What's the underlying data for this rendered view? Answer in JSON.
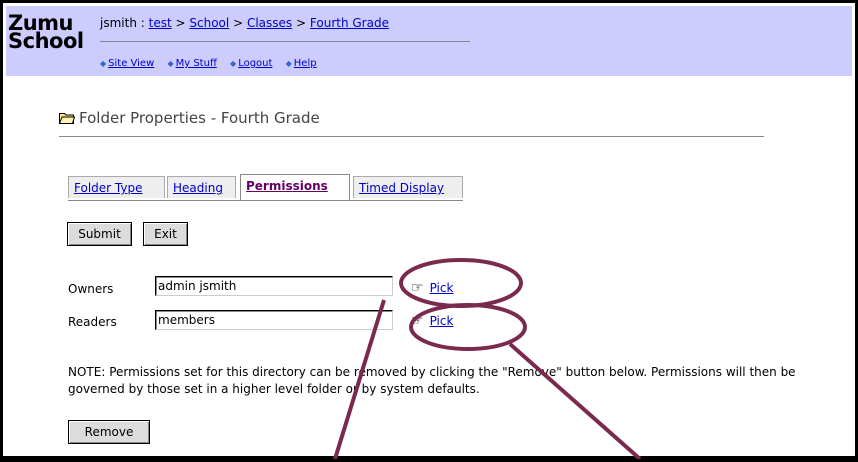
{
  "logo": {
    "line1": "Zumu",
    "line2": "School"
  },
  "breadcrumb": {
    "user": "jsmith",
    "separator": ":",
    "items": [
      "test",
      "School",
      "Classes",
      "Fourth Grade"
    ]
  },
  "nav": {
    "links": [
      "Site View",
      "My Stuff",
      "Logout",
      "Help"
    ]
  },
  "page": {
    "title": "Folder Properties - Fourth Grade"
  },
  "tabs": [
    {
      "label": "Folder Type",
      "active": false
    },
    {
      "label": "Heading",
      "active": false
    },
    {
      "label": "Permissions",
      "active": true
    },
    {
      "label": "Timed Display",
      "active": false
    }
  ],
  "buttons": {
    "submit": "Submit",
    "exit": "Exit",
    "remove": "Remove"
  },
  "permissions": {
    "owners_label": "Owners",
    "owners_value": "admin jsmith",
    "readers_label": "Readers",
    "readers_value": "members",
    "pick_label": "Pick"
  },
  "note": "NOTE: Permissions set for this directory can be removed by clicking the \"Remove\" button below. Permissions will then be governed by those set in a higher level folder or by system defaults.",
  "colors": {
    "header_bg": "#ccccff",
    "link": "#0000cc",
    "annotation": "#7a2a4e"
  },
  "icons": {
    "folder": "folder-icon",
    "pick": "pointing-hand-icon",
    "nav_bullet": "diamond-icon"
  }
}
